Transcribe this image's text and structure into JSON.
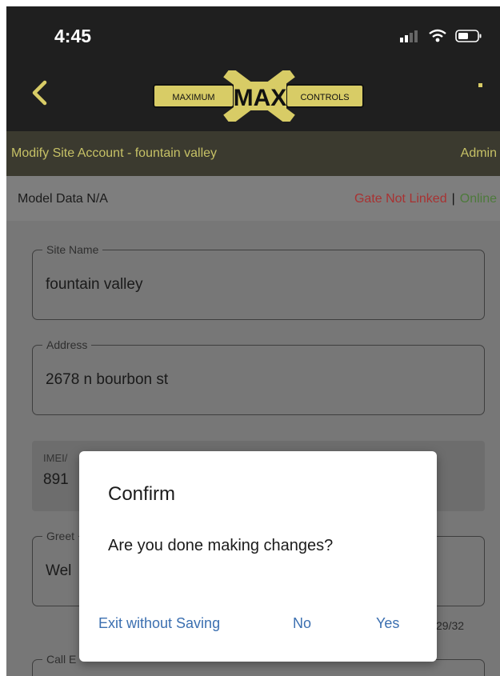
{
  "status_bar": {
    "time": "4:45"
  },
  "header": {
    "logo": {
      "left_text": "MAXIMUM",
      "center_text": "MAX",
      "right_text": "CONTROLS"
    },
    "accent_color": "#d8cc66"
  },
  "title_bar": {
    "title": "Modify Site Account - fountain valley",
    "role": "Admin"
  },
  "status_row": {
    "model": "Model Data N/A",
    "gate_status": "Gate Not Linked",
    "separator": "|",
    "connection": "Online"
  },
  "form": {
    "site_name": {
      "label": "Site Name",
      "value": "fountain valley"
    },
    "address": {
      "label": "Address",
      "value": "2678 n bourbon st"
    },
    "imei": {
      "label": "IMEI/",
      "value": "891"
    },
    "greeting": {
      "label": "Greet",
      "value": "Wel"
    },
    "counter": "29/32",
    "call": {
      "label": "Call E"
    }
  },
  "dialog": {
    "title": "Confirm",
    "message": "Are you done making changes?",
    "buttons": {
      "exit": "Exit without Saving",
      "no": "No",
      "yes": "Yes"
    }
  }
}
